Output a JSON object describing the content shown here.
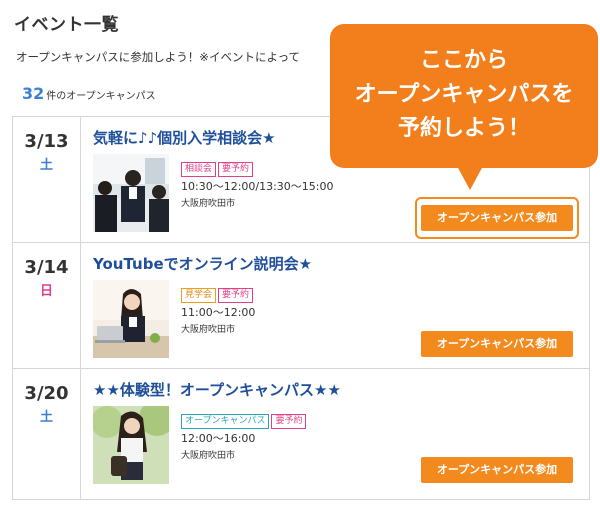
{
  "header": {
    "title": "イベント一覧",
    "intro": "オープンキャンパスに参加しよう！※イベントによって",
    "count_num": "32",
    "count_label": "件のオープンキャンパス"
  },
  "events": [
    {
      "date": "3/13",
      "dow": "土",
      "title": "気軽に♪♪個別入学相談会★",
      "tags": [
        "相談会",
        "要予約"
      ],
      "time": "10:30～12:00/13:30～15:00",
      "place": "大阪府吹田市",
      "button": "オープンキャンパス参加"
    },
    {
      "date": "3/14",
      "dow": "日",
      "title": "YouTubeでオンライン説明会★",
      "tags": [
        "見学会",
        "要予約"
      ],
      "time": "11:00～12:00",
      "place": "大阪府吹田市",
      "button": "オープンキャンパス参加"
    },
    {
      "date": "3/20",
      "dow": "土",
      "title": "★★体験型！オープンキャンパス★★",
      "tags": [
        "オープンキャンパス",
        "要予約"
      ],
      "time": "12:00～16:00",
      "place": "大阪府吹田市",
      "button": "オープンキャンパス参加"
    }
  ],
  "callout": {
    "line1": "ここから",
    "line2": "オープンキャンパスを",
    "line3": "予約しよう！"
  },
  "colors": {
    "accent": "#f28a1e",
    "title_blue": "#1f4f9a",
    "saturday": "#3d7fd0",
    "sunday": "#e0408a"
  }
}
